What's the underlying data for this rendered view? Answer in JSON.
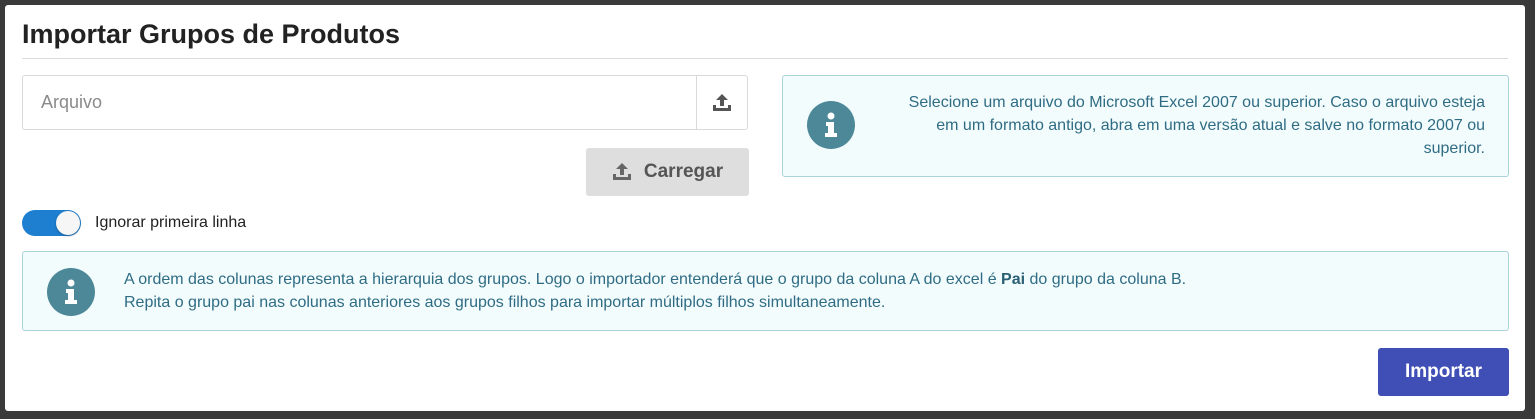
{
  "page": {
    "title": "Importar Grupos de Produtos"
  },
  "file": {
    "placeholder": "Arquivo",
    "upload_icon": "upload-icon"
  },
  "load_button": {
    "label": "Carregar",
    "icon": "upload-icon"
  },
  "toggle": {
    "label": "Ignorar primeira linha",
    "checked": true
  },
  "info_right": {
    "icon": "info-icon",
    "line1": "Selecione um arquivo do Microsoft Excel 2007 ou superior. Caso o arquivo esteja",
    "line2": "em um formato antigo, abra em uma versão atual e salve no formato 2007 ou",
    "line3": "superior."
  },
  "info_bottom": {
    "icon": "info-icon",
    "line1_before": "A ordem das colunas representa a hierarquia dos grupos. Logo o importador entenderá que o grupo da coluna A do excel é ",
    "line1_bold": "Pai",
    "line1_after": " do grupo da coluna B.",
    "line2": "Repita o grupo pai nas colunas anteriores aos grupos filhos para importar múltiplos filhos simultaneamente."
  },
  "import_button": {
    "label": "Importar"
  },
  "colors": {
    "primary": "#3f4fb5",
    "toggle": "#1e7fd0",
    "info_bg": "#f3fcfd",
    "info_border": "#a9d4da",
    "info_icon": "#4d8898",
    "info_text": "#2f6c84"
  }
}
